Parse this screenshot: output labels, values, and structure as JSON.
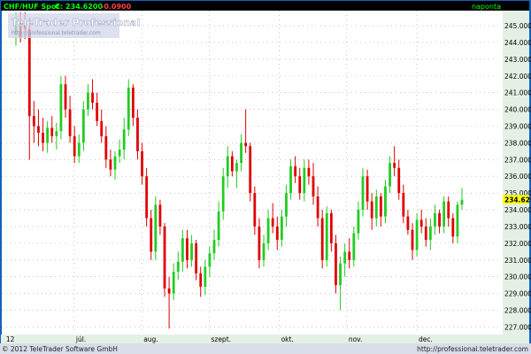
{
  "header": {
    "symbol": "CHF/HUF Spot",
    "last_label": "C:",
    "last_value": "234.6200",
    "change": "-0.0900",
    "interval": "naponta"
  },
  "watermark": {
    "brand": "TeleTrader Professional",
    "url": "http://professional.teletrader.com"
  },
  "footer": {
    "copyright": "© 2012 TeleTrader Software GmbH",
    "url": "http://professional.teletrader.com"
  },
  "colors": {
    "background": "#ffffff",
    "axis_panel": "#e4f0e4",
    "up": "#22cc22",
    "down": "#e00000",
    "grid": "#a0a0a0",
    "header_bg": "#000000",
    "header_text": "#00ff00",
    "header_change": "#ff4040",
    "last_price_bg": "#ffff00",
    "frame": "#1560bd",
    "footer_bg": "#d8dde8"
  },
  "chart_data": {
    "type": "candlestick",
    "x_tick_labels": [
      "12",
      "júl.",
      "aug.",
      "szept.",
      "okt.",
      "nov.",
      "dec."
    ],
    "y_tick_labels": [
      "227.0000",
      "228.0000",
      "229.0000",
      "230.0000",
      "231.0000",
      "232.0000",
      "233.0000",
      "234.0000",
      "235.0000",
      "236.0000",
      "237.0000",
      "238.0000",
      "239.0000",
      "240.0000",
      "241.0000",
      "242.0000",
      "243.0000",
      "244.0000",
      "245.0000"
    ],
    "ylim": [
      226.6,
      245.9
    ],
    "last_price": 234.62,
    "last_price_label": "234.6200",
    "grid": true,
    "ohlc_sample": [
      {
        "o": 244.5,
        "h": 245.8,
        "l": 243.8,
        "c": 245.0
      },
      {
        "o": 245.2,
        "h": 245.8,
        "l": 244.0,
        "c": 244.3
      },
      {
        "o": 245.3,
        "h": 245.8,
        "l": 244.2,
        "c": 244.8
      },
      {
        "o": 244.8,
        "h": 245.5,
        "l": 237.0,
        "c": 239.6
      },
      {
        "o": 239.6,
        "h": 240.5,
        "l": 238.0,
        "c": 239.0
      },
      {
        "o": 239.0,
        "h": 240.0,
        "l": 237.8,
        "c": 238.6
      },
      {
        "o": 238.6,
        "h": 239.5,
        "l": 237.5,
        "c": 238.0
      },
      {
        "o": 238.0,
        "h": 239.3,
        "l": 237.4,
        "c": 238.9
      },
      {
        "o": 238.9,
        "h": 239.6,
        "l": 238.0,
        "c": 238.4
      },
      {
        "o": 238.4,
        "h": 239.2,
        "l": 237.6,
        "c": 238.7
      },
      {
        "o": 238.7,
        "h": 242.0,
        "l": 238.2,
        "c": 241.5
      },
      {
        "o": 241.5,
        "h": 242.0,
        "l": 239.5,
        "c": 240.0
      },
      {
        "o": 240.0,
        "h": 240.8,
        "l": 238.0,
        "c": 238.4
      },
      {
        "o": 238.4,
        "h": 239.0,
        "l": 236.8,
        "c": 237.2
      },
      {
        "o": 237.2,
        "h": 238.5,
        "l": 236.8,
        "c": 238.0
      },
      {
        "o": 238.0,
        "h": 240.5,
        "l": 237.5,
        "c": 240.0
      },
      {
        "o": 240.0,
        "h": 241.5,
        "l": 239.6,
        "c": 241.0
      },
      {
        "o": 241.0,
        "h": 241.8,
        "l": 240.0,
        "c": 240.4
      },
      {
        "o": 240.4,
        "h": 241.0,
        "l": 239.0,
        "c": 239.3
      },
      {
        "o": 239.3,
        "h": 240.0,
        "l": 238.0,
        "c": 238.4
      },
      {
        "o": 238.4,
        "h": 239.0,
        "l": 236.5,
        "c": 237.0
      },
      {
        "o": 237.0,
        "h": 237.6,
        "l": 236.0,
        "c": 236.4
      },
      {
        "o": 236.4,
        "h": 237.5,
        "l": 235.8,
        "c": 237.2
      },
      {
        "o": 237.2,
        "h": 238.2,
        "l": 236.8,
        "c": 237.6
      },
      {
        "o": 237.6,
        "h": 239.5,
        "l": 237.0,
        "c": 238.8
      },
      {
        "o": 238.8,
        "h": 241.8,
        "l": 238.4,
        "c": 241.3
      },
      {
        "o": 241.3,
        "h": 241.5,
        "l": 239.0,
        "c": 239.5
      },
      {
        "o": 239.5,
        "h": 240.0,
        "l": 237.0,
        "c": 237.5
      },
      {
        "o": 237.5,
        "h": 238.0,
        "l": 235.5,
        "c": 236.0
      },
      {
        "o": 236.0,
        "h": 236.5,
        "l": 233.0,
        "c": 233.5
      },
      {
        "o": 233.5,
        "h": 234.0,
        "l": 231.0,
        "c": 231.5
      },
      {
        "o": 231.5,
        "h": 234.8,
        "l": 231.0,
        "c": 234.3
      },
      {
        "o": 234.3,
        "h": 234.6,
        "l": 232.5,
        "c": 233.0
      },
      {
        "o": 233.0,
        "h": 233.2,
        "l": 228.8,
        "c": 229.3
      },
      {
        "o": 229.3,
        "h": 230.0,
        "l": 226.9,
        "c": 229.0
      },
      {
        "o": 229.0,
        "h": 230.8,
        "l": 228.6,
        "c": 230.3
      },
      {
        "o": 230.3,
        "h": 231.5,
        "l": 229.8,
        "c": 230.9
      },
      {
        "o": 230.9,
        "h": 232.8,
        "l": 230.3,
        "c": 232.3
      },
      {
        "o": 232.3,
        "h": 232.8,
        "l": 230.5,
        "c": 231.0
      },
      {
        "o": 231.0,
        "h": 232.5,
        "l": 230.6,
        "c": 232.0
      },
      {
        "o": 232.0,
        "h": 232.2,
        "l": 229.8,
        "c": 230.2
      },
      {
        "o": 230.2,
        "h": 230.6,
        "l": 228.8,
        "c": 229.4
      },
      {
        "o": 229.4,
        "h": 231.0,
        "l": 228.9,
        "c": 230.6
      },
      {
        "o": 230.6,
        "h": 231.8,
        "l": 230.0,
        "c": 231.4
      },
      {
        "o": 231.4,
        "h": 232.8,
        "l": 231.0,
        "c": 232.2
      },
      {
        "o": 232.2,
        "h": 234.5,
        "l": 231.8,
        "c": 233.9
      },
      {
        "o": 233.9,
        "h": 236.5,
        "l": 233.4,
        "c": 236.0
      },
      {
        "o": 236.0,
        "h": 237.8,
        "l": 235.3,
        "c": 237.2
      },
      {
        "o": 237.2,
        "h": 237.5,
        "l": 236.0,
        "c": 236.3
      },
      {
        "o": 236.3,
        "h": 237.0,
        "l": 235.3,
        "c": 236.8
      },
      {
        "o": 236.8,
        "h": 238.5,
        "l": 236.3,
        "c": 238.0
      },
      {
        "o": 238.0,
        "h": 240.0,
        "l": 237.4,
        "c": 237.8
      },
      {
        "o": 237.8,
        "h": 238.0,
        "l": 234.5,
        "c": 235.0
      },
      {
        "o": 235.0,
        "h": 235.4,
        "l": 232.5,
        "c": 233.0
      },
      {
        "o": 233.0,
        "h": 233.5,
        "l": 230.5,
        "c": 231.0
      },
      {
        "o": 231.0,
        "h": 232.5,
        "l": 230.6,
        "c": 232.0
      },
      {
        "o": 232.0,
        "h": 234.0,
        "l": 231.6,
        "c": 233.5
      },
      {
        "o": 233.5,
        "h": 234.4,
        "l": 232.6,
        "c": 233.0
      },
      {
        "o": 233.0,
        "h": 233.6,
        "l": 231.6,
        "c": 232.2
      },
      {
        "o": 232.2,
        "h": 234.0,
        "l": 231.8,
        "c": 233.6
      },
      {
        "o": 233.6,
        "h": 235.5,
        "l": 233.0,
        "c": 235.0
      },
      {
        "o": 235.0,
        "h": 237.0,
        "l": 234.6,
        "c": 236.6
      },
      {
        "o": 236.6,
        "h": 237.2,
        "l": 235.6,
        "c": 236.0
      },
      {
        "o": 236.0,
        "h": 236.5,
        "l": 234.6,
        "c": 235.0
      },
      {
        "o": 235.0,
        "h": 237.0,
        "l": 234.5,
        "c": 236.5
      },
      {
        "o": 236.5,
        "h": 237.0,
        "l": 235.5,
        "c": 236.0
      },
      {
        "o": 236.0,
        "h": 236.8,
        "l": 234.3,
        "c": 234.8
      },
      {
        "o": 234.8,
        "h": 235.4,
        "l": 233.0,
        "c": 233.5
      },
      {
        "o": 233.5,
        "h": 234.0,
        "l": 230.5,
        "c": 231.0
      },
      {
        "o": 231.0,
        "h": 234.2,
        "l": 230.6,
        "c": 233.8
      },
      {
        "o": 233.8,
        "h": 234.0,
        "l": 231.5,
        "c": 232.0
      },
      {
        "o": 232.0,
        "h": 232.5,
        "l": 229.0,
        "c": 229.5
      },
      {
        "o": 229.5,
        "h": 231.2,
        "l": 228.0,
        "c": 230.8
      },
      {
        "o": 230.8,
        "h": 232.0,
        "l": 230.0,
        "c": 231.5
      },
      {
        "o": 231.5,
        "h": 232.3,
        "l": 230.5,
        "c": 231.0
      },
      {
        "o": 231.0,
        "h": 233.0,
        "l": 230.6,
        "c": 232.6
      },
      {
        "o": 232.6,
        "h": 234.5,
        "l": 232.2,
        "c": 234.0
      },
      {
        "o": 234.0,
        "h": 236.5,
        "l": 233.6,
        "c": 236.0
      },
      {
        "o": 236.0,
        "h": 236.4,
        "l": 234.0,
        "c": 234.5
      },
      {
        "o": 234.5,
        "h": 235.0,
        "l": 232.8,
        "c": 233.5
      },
      {
        "o": 233.5,
        "h": 235.2,
        "l": 233.0,
        "c": 234.8
      },
      {
        "o": 234.8,
        "h": 235.0,
        "l": 233.0,
        "c": 233.6
      },
      {
        "o": 233.6,
        "h": 235.8,
        "l": 233.2,
        "c": 235.4
      },
      {
        "o": 235.4,
        "h": 237.2,
        "l": 235.0,
        "c": 236.8
      },
      {
        "o": 236.8,
        "h": 237.8,
        "l": 236.0,
        "c": 236.5
      },
      {
        "o": 236.5,
        "h": 237.0,
        "l": 234.6,
        "c": 235.0
      },
      {
        "o": 235.0,
        "h": 235.5,
        "l": 233.2,
        "c": 233.6
      },
      {
        "o": 233.6,
        "h": 234.0,
        "l": 232.5,
        "c": 232.8
      },
      {
        "o": 232.8,
        "h": 233.2,
        "l": 231.0,
        "c": 231.6
      },
      {
        "o": 231.6,
        "h": 233.8,
        "l": 231.2,
        "c": 233.4
      },
      {
        "o": 233.4,
        "h": 234.0,
        "l": 232.6,
        "c": 233.0
      },
      {
        "o": 233.0,
        "h": 233.5,
        "l": 231.8,
        "c": 232.2
      },
      {
        "o": 232.2,
        "h": 233.5,
        "l": 231.6,
        "c": 233.0
      },
      {
        "o": 233.0,
        "h": 234.3,
        "l": 232.5,
        "c": 233.8
      },
      {
        "o": 233.8,
        "h": 234.0,
        "l": 232.6,
        "c": 233.0
      },
      {
        "o": 233.0,
        "h": 234.8,
        "l": 232.6,
        "c": 234.5
      },
      {
        "o": 234.5,
        "h": 234.8,
        "l": 233.0,
        "c": 233.5
      },
      {
        "o": 233.5,
        "h": 233.8,
        "l": 232.0,
        "c": 232.4
      },
      {
        "o": 232.4,
        "h": 234.5,
        "l": 232.0,
        "c": 234.3
      },
      {
        "o": 234.3,
        "h": 235.3,
        "l": 234.0,
        "c": 234.6
      }
    ]
  }
}
